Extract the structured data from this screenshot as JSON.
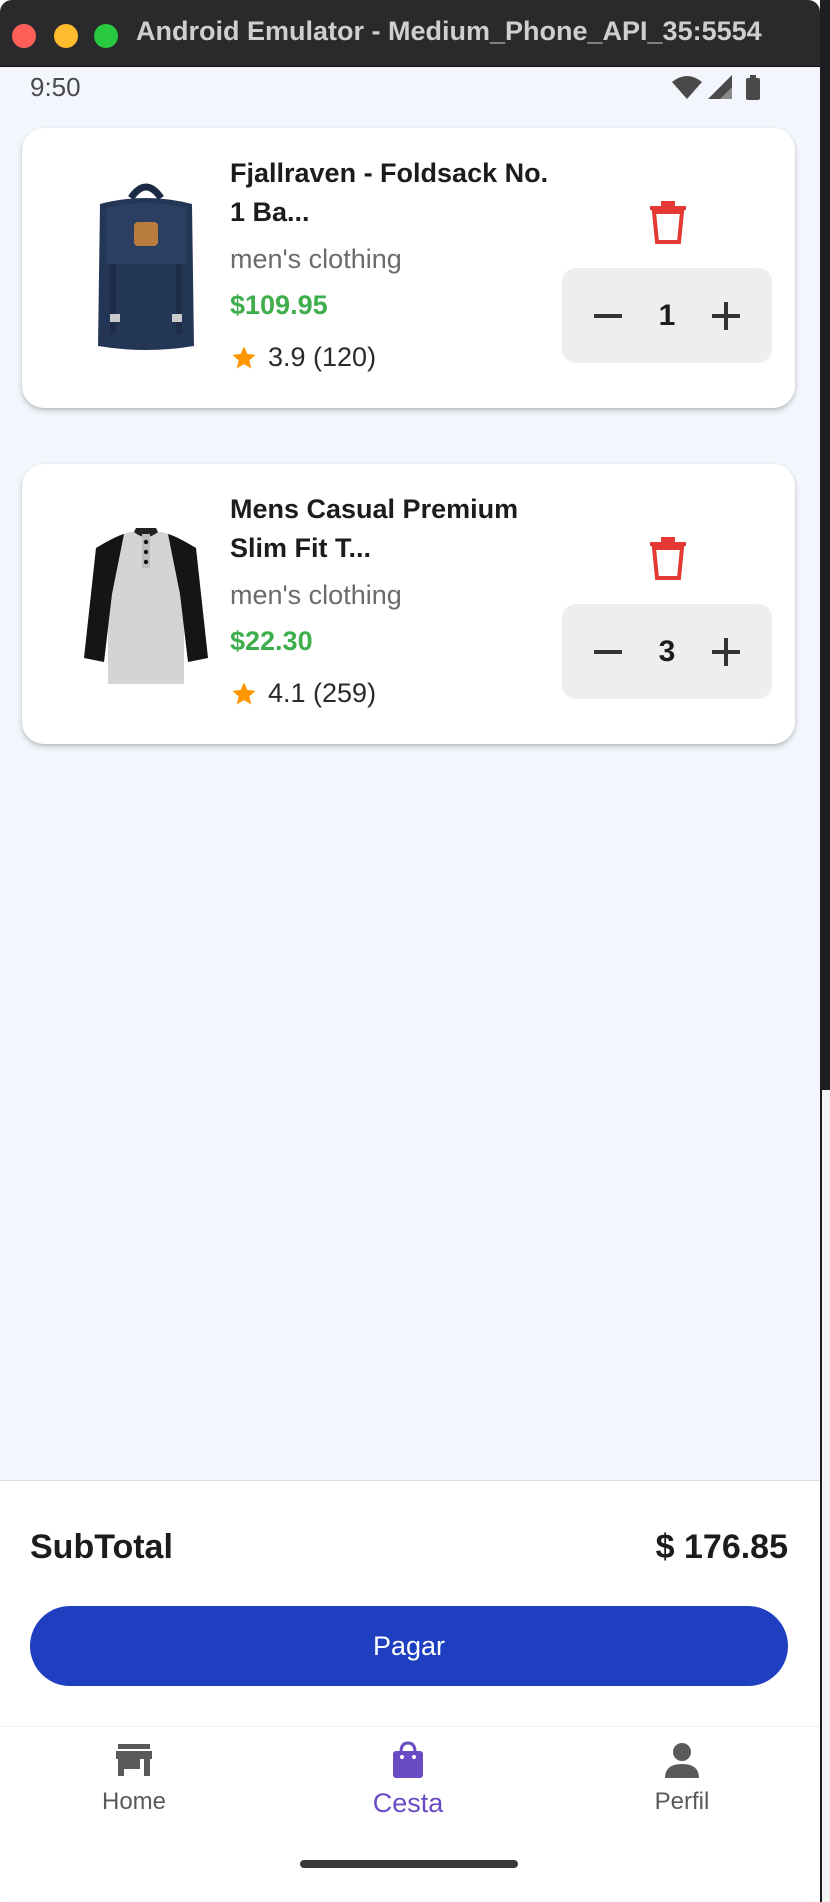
{
  "window": {
    "title": "Android Emulator - Medium_Phone_API_35:5554"
  },
  "status_bar": {
    "time": "9:50",
    "icons": [
      "wifi-icon",
      "signal-icon",
      "battery-icon"
    ]
  },
  "cart": {
    "items": [
      {
        "title_line1": "Fjallraven - Foldsack No.",
        "title_line2": "1 Ba...",
        "category": "men's clothing",
        "price": "$109.95",
        "rating": "3.9 (120)",
        "quantity": "1",
        "image": "backpack-image"
      },
      {
        "title_line1": "Mens Casual Premium",
        "title_line2": "Slim Fit T...",
        "category": "men's clothing",
        "price": "$22.30",
        "rating": "4.1 (259)",
        "quantity": "3",
        "image": "tshirt-image"
      }
    ]
  },
  "summary": {
    "subtotal_label": "SubTotal",
    "subtotal_value": "$ 176.85",
    "pay_label": "Pagar"
  },
  "bottom_nav": {
    "items": [
      {
        "label": "Home",
        "icon": "store-icon"
      },
      {
        "label": "Cesta",
        "icon": "shopping-bag-icon",
        "active": true
      },
      {
        "label": "Perfil",
        "icon": "person-icon"
      }
    ]
  },
  "colors": {
    "primary": "#1e40c0",
    "active_nav": "#6a4bc4",
    "price": "#3fae4c",
    "delete": "#e53935",
    "star": "#ff9800",
    "background": "#f3f6fc"
  }
}
